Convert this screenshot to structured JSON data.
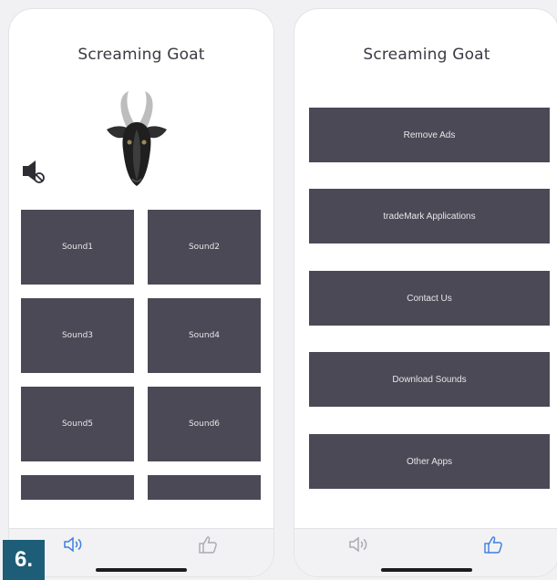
{
  "left_screen": {
    "title": "Screaming Goat",
    "sounds": [
      "Sound1",
      "Sound2",
      "Sound3",
      "Sound4",
      "Sound5",
      "Sound6",
      "",
      ""
    ],
    "tabs": [
      {
        "icon": "speaker-icon",
        "active": true
      },
      {
        "icon": "thumbs-up-icon",
        "active": false
      }
    ]
  },
  "right_screen": {
    "title": "Screaming Goat",
    "menu": [
      "Remove Ads",
      "tradeMark Applications",
      "Contact Us",
      "Download Sounds",
      "Other Apps"
    ],
    "tabs": [
      {
        "icon": "speaker-icon",
        "active": false
      },
      {
        "icon": "thumbs-up-icon",
        "active": true
      }
    ]
  },
  "step_badge": "6.",
  "colors": {
    "tile": "#4b4955",
    "tile_text": "#e6e6ea",
    "tab_active": "#3d7ee0",
    "tab_inactive": "#a9a9b1"
  }
}
